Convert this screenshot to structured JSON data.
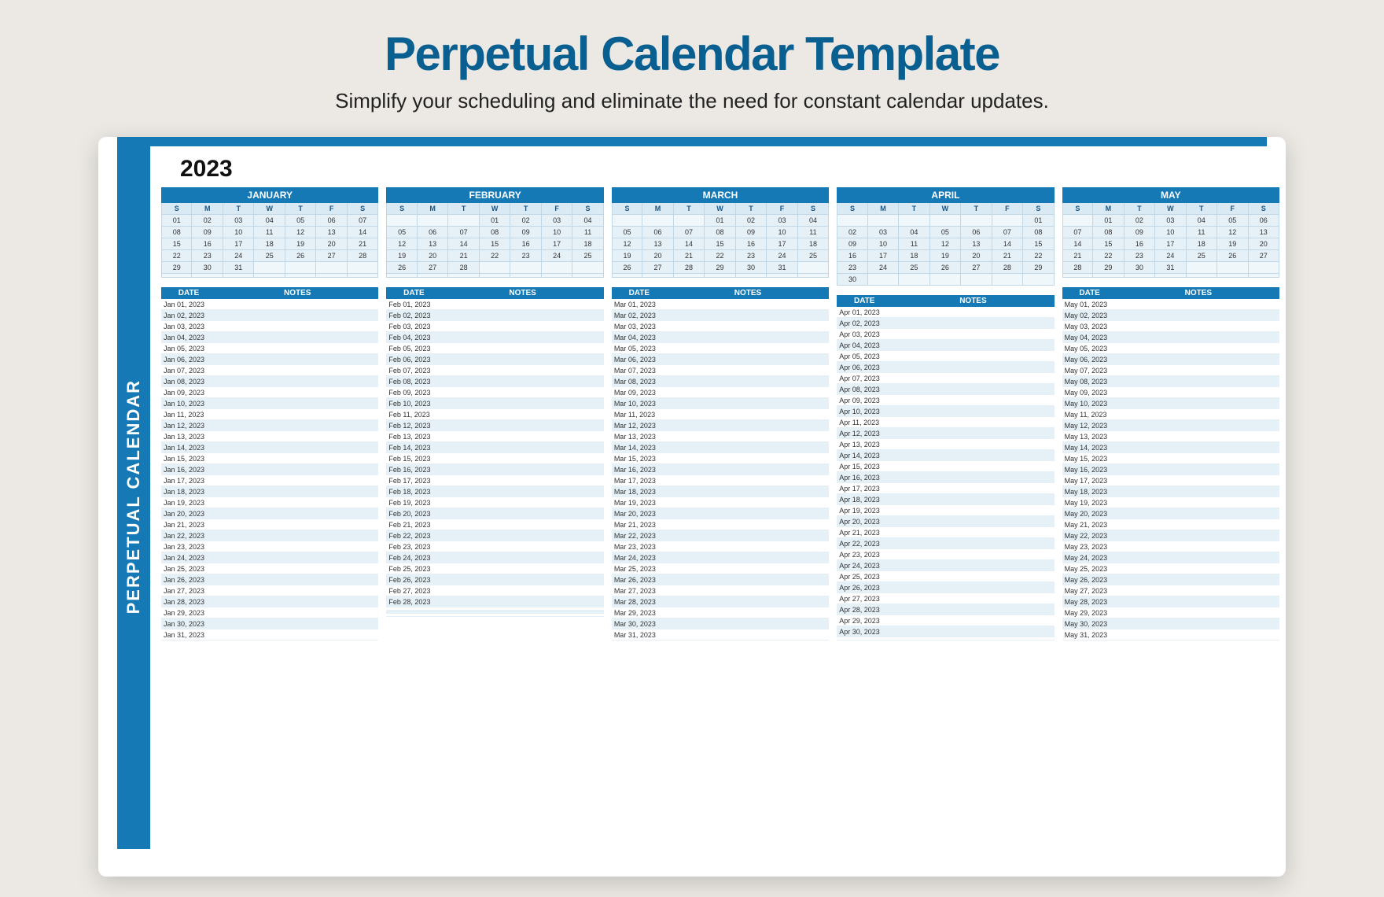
{
  "page": {
    "title": "Perpetual Calendar Template",
    "subtitle": "Simplify your scheduling and eliminate the need for constant calendar updates."
  },
  "sidebarLabel": "PERPETUAL CALENDAR",
  "year": "2023",
  "dow": [
    "S",
    "M",
    "T",
    "W",
    "T",
    "F",
    "S"
  ],
  "notesHeader": {
    "date": "DATE",
    "notes": "NOTES"
  },
  "months": [
    {
      "name": "JANUARY",
      "abbr": "Jan",
      "days": 31,
      "weeks": [
        [
          "01",
          "02",
          "03",
          "04",
          "05",
          "06",
          "07"
        ],
        [
          "08",
          "09",
          "10",
          "11",
          "12",
          "13",
          "14"
        ],
        [
          "15",
          "16",
          "17",
          "18",
          "19",
          "20",
          "21"
        ],
        [
          "22",
          "23",
          "24",
          "25",
          "26",
          "27",
          "28"
        ],
        [
          "29",
          "30",
          "31",
          "",
          "",
          "",
          ""
        ],
        [
          "",
          "",
          "",
          "",
          "",
          "",
          ""
        ]
      ]
    },
    {
      "name": "FEBRUARY",
      "abbr": "Feb",
      "days": 28,
      "weeks": [
        [
          "",
          "",
          "",
          "01",
          "02",
          "03",
          "04"
        ],
        [
          "05",
          "06",
          "07",
          "08",
          "09",
          "10",
          "11"
        ],
        [
          "12",
          "13",
          "14",
          "15",
          "16",
          "17",
          "18"
        ],
        [
          "19",
          "20",
          "21",
          "22",
          "23",
          "24",
          "25"
        ],
        [
          "26",
          "27",
          "28",
          "",
          "",
          "",
          ""
        ],
        [
          "",
          "",
          "",
          "",
          "",
          "",
          ""
        ]
      ]
    },
    {
      "name": "MARCH",
      "abbr": "Mar",
      "days": 31,
      "weeks": [
        [
          "",
          "",
          "",
          "01",
          "02",
          "03",
          "04"
        ],
        [
          "05",
          "06",
          "07",
          "08",
          "09",
          "10",
          "11"
        ],
        [
          "12",
          "13",
          "14",
          "15",
          "16",
          "17",
          "18"
        ],
        [
          "19",
          "20",
          "21",
          "22",
          "23",
          "24",
          "25"
        ],
        [
          "26",
          "27",
          "28",
          "29",
          "30",
          "31",
          ""
        ],
        [
          "",
          "",
          "",
          "",
          "",
          "",
          ""
        ]
      ]
    },
    {
      "name": "APRIL",
      "abbr": "Apr",
      "days": 30,
      "weeks": [
        [
          "",
          "",
          "",
          "",
          "",
          "",
          "01"
        ],
        [
          "02",
          "03",
          "04",
          "05",
          "06",
          "07",
          "08"
        ],
        [
          "09",
          "10",
          "11",
          "12",
          "13",
          "14",
          "15"
        ],
        [
          "16",
          "17",
          "18",
          "19",
          "20",
          "21",
          "22"
        ],
        [
          "23",
          "24",
          "25",
          "26",
          "27",
          "28",
          "29"
        ],
        [
          "30",
          "",
          "",
          "",
          "",
          "",
          ""
        ]
      ]
    },
    {
      "name": "MAY",
      "abbr": "May",
      "days": 31,
      "weeks": [
        [
          "",
          "01",
          "02",
          "03",
          "04",
          "05",
          "06"
        ],
        [
          "07",
          "08",
          "09",
          "10",
          "11",
          "12",
          "13"
        ],
        [
          "14",
          "15",
          "16",
          "17",
          "18",
          "19",
          "20"
        ],
        [
          "21",
          "22",
          "23",
          "24",
          "25",
          "26",
          "27"
        ],
        [
          "28",
          "29",
          "30",
          "31",
          "",
          "",
          ""
        ],
        [
          "",
          "",
          "",
          "",
          "",
          "",
          ""
        ]
      ]
    }
  ]
}
